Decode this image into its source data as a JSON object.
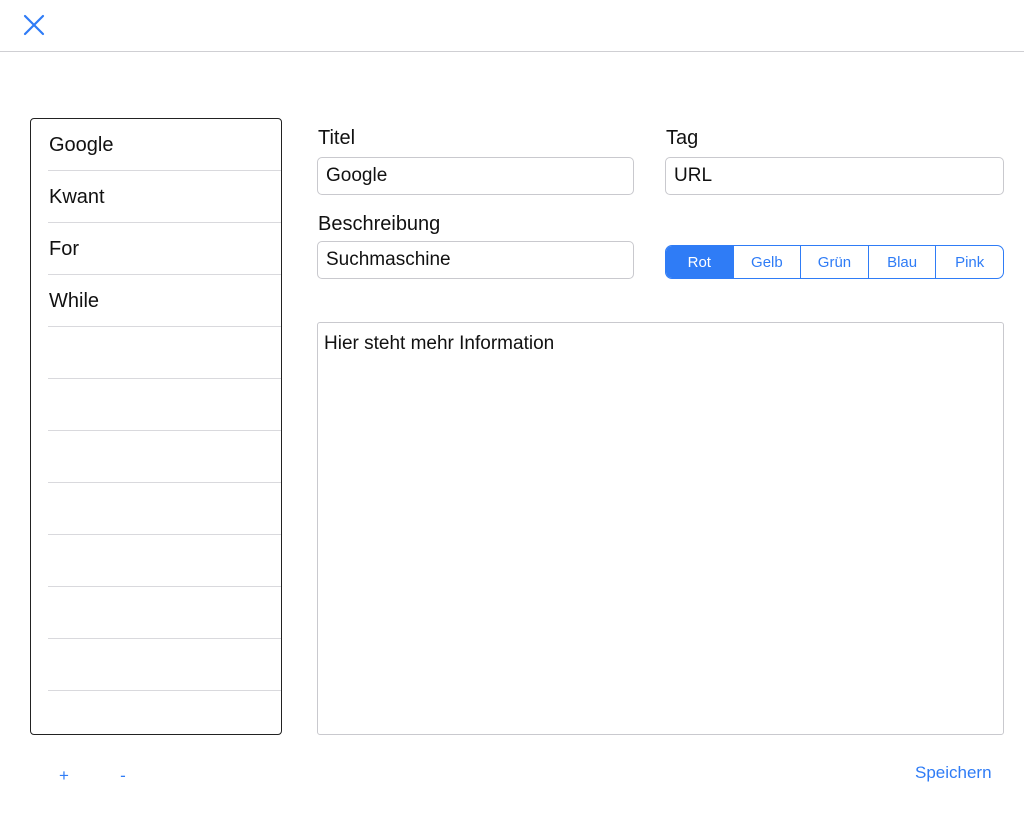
{
  "header": {
    "close_icon": "close-icon"
  },
  "list": {
    "items": [
      {
        "label": "Google"
      },
      {
        "label": "Kwant"
      },
      {
        "label": "For"
      },
      {
        "label": "While"
      },
      {
        "label": ""
      },
      {
        "label": ""
      },
      {
        "label": ""
      },
      {
        "label": ""
      },
      {
        "label": ""
      },
      {
        "label": ""
      },
      {
        "label": ""
      },
      {
        "label": ""
      }
    ],
    "add_label": "+",
    "remove_label": "-"
  },
  "form": {
    "title_label": "Titel",
    "title_value": "Google",
    "tag_label": "Tag",
    "tag_value": "URL",
    "description_label": "Beschreibung",
    "description_value": "Suchmaschine",
    "colors": [
      "Rot",
      "Gelb",
      "Grün",
      "Blau",
      "Pink"
    ],
    "selected_color": "Rot",
    "info_value": "Hier steht mehr Information",
    "save_label": "Speichern"
  },
  "theme": {
    "accent": "#2f7cf6"
  }
}
